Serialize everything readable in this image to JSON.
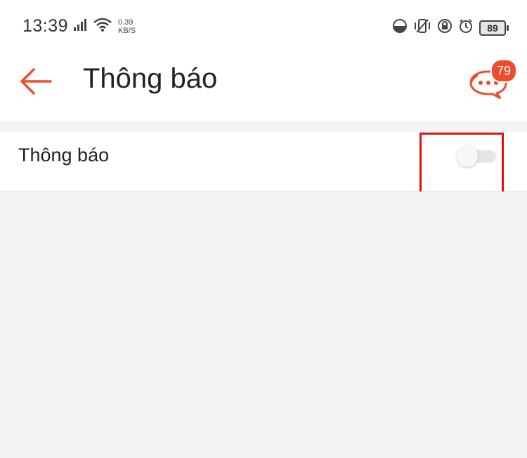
{
  "status_bar": {
    "time": "13:39",
    "net_speed_value": "0.39",
    "net_speed_unit": "KB/S",
    "battery": "89",
    "icons": [
      "signal-icon",
      "wifi-icon",
      "data-saver-icon",
      "vibrate-icon",
      "lock-rotation-icon",
      "alarm-icon",
      "battery-icon"
    ]
  },
  "header": {
    "title": "Thông báo",
    "back_icon": "arrow-left-icon",
    "chat_icon": "chat-bubbles-icon",
    "chat_badge": "79"
  },
  "settings": {
    "items": [
      {
        "label": "Thông báo",
        "toggle_on": false
      }
    ]
  },
  "colors": {
    "accent": "#ee4d2d",
    "highlight": "#e01010",
    "background": "#f3f3f3",
    "surface": "#ffffff"
  }
}
